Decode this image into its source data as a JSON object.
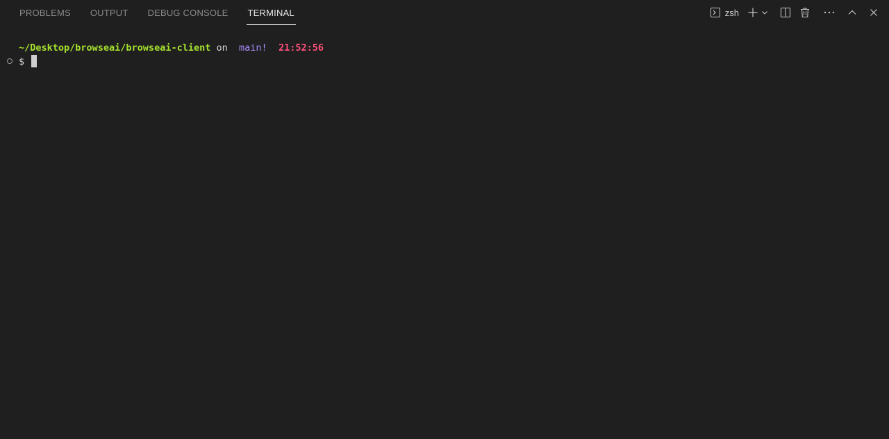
{
  "tabs": [
    {
      "label": "PROBLEMS",
      "active": false
    },
    {
      "label": "OUTPUT",
      "active": false
    },
    {
      "label": "DEBUG CONSOLE",
      "active": false
    },
    {
      "label": "TERMINAL",
      "active": true
    }
  ],
  "toolbar": {
    "shell_name": "zsh",
    "icons": [
      "terminal-icon",
      "plus-icon",
      "chevron-down-icon",
      "split-icon",
      "trash-icon",
      "more-icon",
      "chevron-up-icon",
      "close-icon"
    ]
  },
  "terminal": {
    "prompt_line": {
      "path": "~/Desktop/browseai/browseai-client",
      "on_word": "on",
      "branch_glyph": "",
      "branch": "main!",
      "clock_glyph": "",
      "time": "21:52:56"
    },
    "input_line": {
      "prompt_symbol": "$"
    }
  },
  "colors": {
    "background": "#1f1f1f",
    "path": "#a6e22e",
    "branch": "#a78bfa",
    "time": "#ff4f7b",
    "active_tab": "#e6e6e6",
    "inactive_tab": "#8b8b8b"
  }
}
